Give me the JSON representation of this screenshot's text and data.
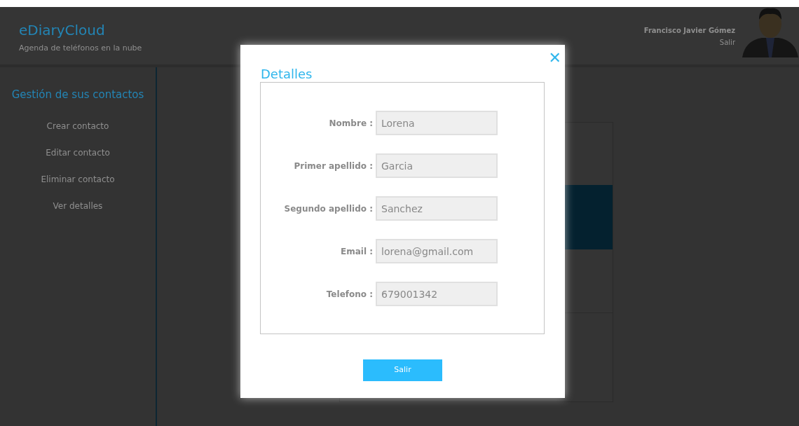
{
  "header": {
    "title": "eDiaryCloud",
    "subtitle": "Agenda de teléfonos en la nube",
    "user_name": "Francisco Javier Gómez",
    "logout": "Salir"
  },
  "sidebar": {
    "title": "Gestión de sus contactos",
    "items": [
      {
        "label": "Crear contacto"
      },
      {
        "label": "Editar contacto"
      },
      {
        "label": "Eliminar contacto"
      },
      {
        "label": "Ver detalles"
      }
    ]
  },
  "dialog": {
    "title": "Detalles",
    "close": "✕",
    "fields": [
      {
        "label": "Nombre :",
        "value": "Lorena"
      },
      {
        "label": "Primer apellido :",
        "value": "Garcia"
      },
      {
        "label": "Segundo apellido :",
        "value": "Sanchez"
      },
      {
        "label": "Email :",
        "value": "lorena@gmail.com"
      },
      {
        "label": "Telefono :",
        "value": "679001342"
      }
    ],
    "button": "Salir"
  }
}
